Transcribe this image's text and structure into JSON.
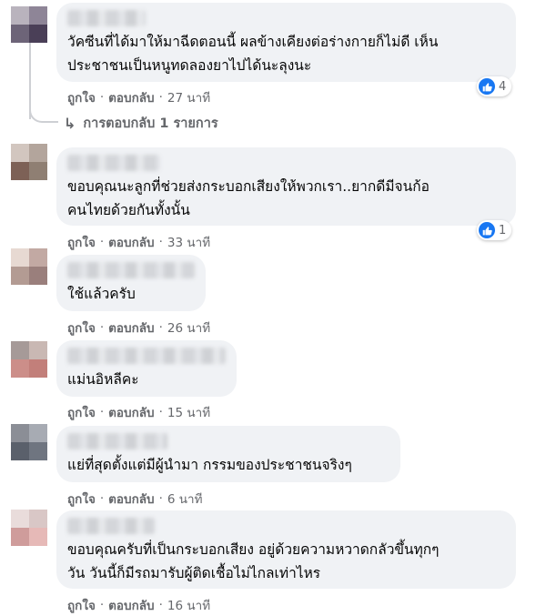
{
  "comments": [
    {
      "text_lines": [
        "วัคซีนที่ได้มาให้มาฉีดตอนนี้ ผลข้างเคียงต่อร่างกายก็ไม่ดี เห็น",
        "ประชาชนเป็นหนูทดลองยาไปได้นะลุงนะ"
      ],
      "like_label": "ถูกใจ",
      "reply_label": "ตอบกลับ",
      "time": "27 นาที",
      "reactions": "4",
      "avatar_colors": [
        "#b9b3bd",
        "#8e8597",
        "#6d6478",
        "#4a3f57"
      ]
    },
    {
      "text_lines": [
        "ขอบคุณนะลูกที่ช่วยส่งกระบอกเสียงให้พวกเรา..ยากดีมีจนก้อ",
        "คนไทยด้วยกันทั้งนั้น"
      ],
      "like_label": "ถูกใจ",
      "reply_label": "ตอบกลับ",
      "time": "33 นาที",
      "reactions": "1",
      "avatar_colors": [
        "#d2c6bf",
        "#b3a59c",
        "#7d6156",
        "#8f7f73"
      ]
    },
    {
      "text_lines": [
        "ใช้แล้วครับ"
      ],
      "like_label": "ถูกใจ",
      "reply_label": "ตอบกลับ",
      "time": "26 นาที",
      "avatar_colors": [
        "#e7d9d2",
        "#c2a9a3",
        "#b39b93",
        "#9a7f7c"
      ]
    },
    {
      "text_lines": [
        "แม่นอิหลีคะ"
      ],
      "like_label": "ถูกใจ",
      "reply_label": "ตอบกลับ",
      "time": "15 นาที",
      "avatar_colors": [
        "#a69a98",
        "#c9b8b3",
        "#cc8e89",
        "#c27f7a"
      ]
    },
    {
      "text_lines": [
        "แย่ที่สุดตั้งแต่มีผู้นำมา กรรมของประชาชนจริงๆ"
      ],
      "like_label": "ถูกใจ",
      "reply_label": "ตอบกลับ",
      "time": "6 นาที",
      "avatar_colors": [
        "#8b8e96",
        "#a7abb3",
        "#5a606b",
        "#6f7580"
      ]
    },
    {
      "text_lines": [
        "ขอบคุณครับที่เป็นกระบอกเสียง อยู่ด้วยความหวาดกลัวขึ้นทุกๆ",
        "วัน วันนี้ก็มีรถมารับผู้ติดเชื้อไม่ไกลเท่าไหร"
      ],
      "like_label": "ถูกใจ",
      "reply_label": "ตอบกลับ",
      "time": "16 นาที",
      "avatar_colors": [
        "#e9dcdb",
        "#d9c7c6",
        "#cf9c9b",
        "#e6b9b7"
      ]
    }
  ],
  "replies_link": "การตอบกลับ 1 รายการ",
  "colors": {
    "bubble": "#f0f2f5",
    "meta": "#65676b",
    "like": "#1877f2"
  }
}
